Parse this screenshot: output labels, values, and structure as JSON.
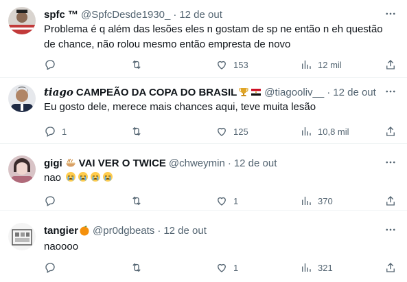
{
  "tweets": [
    {
      "name": "spfc ™",
      "handle": "@SpfcDesde1930_",
      "date": "12 de out",
      "text_lines": [
        "Problema é q além das lesões eles n gostam de sp ne então n eh questão",
        "de chance, não rolou mesmo então empresta de novo"
      ],
      "replies": "",
      "retweets": "",
      "likes": "153",
      "views": "12 mil"
    },
    {
      "name_italic": "tiago",
      "name": "CAMPEÃO DA COPA DO BRASIL",
      "handle": "@tiagooliv__",
      "date": "12 de out",
      "text_lines": [
        "Eu gosto dele, merece mais chances aqui, teve muita lesão"
      ],
      "replies": "1",
      "retweets": "",
      "likes": "125",
      "views": "10,8 mil"
    },
    {
      "name": "gigi",
      "name_suffix": "VAI VER O TWICE",
      "handle": "@chweymin",
      "date": "12 de out",
      "text": "nao",
      "replies": "",
      "retweets": "",
      "likes": "1",
      "views": "370"
    },
    {
      "name": "tangier",
      "handle": "@pr0dgbeats",
      "date": "12 de out",
      "text": "naoooo",
      "replies": "",
      "retweets": "",
      "likes": "1",
      "views": "321"
    }
  ],
  "icons": [
    "reply-icon",
    "retweet-icon",
    "like-icon",
    "views-icon",
    "share-icon",
    "more-icon"
  ]
}
